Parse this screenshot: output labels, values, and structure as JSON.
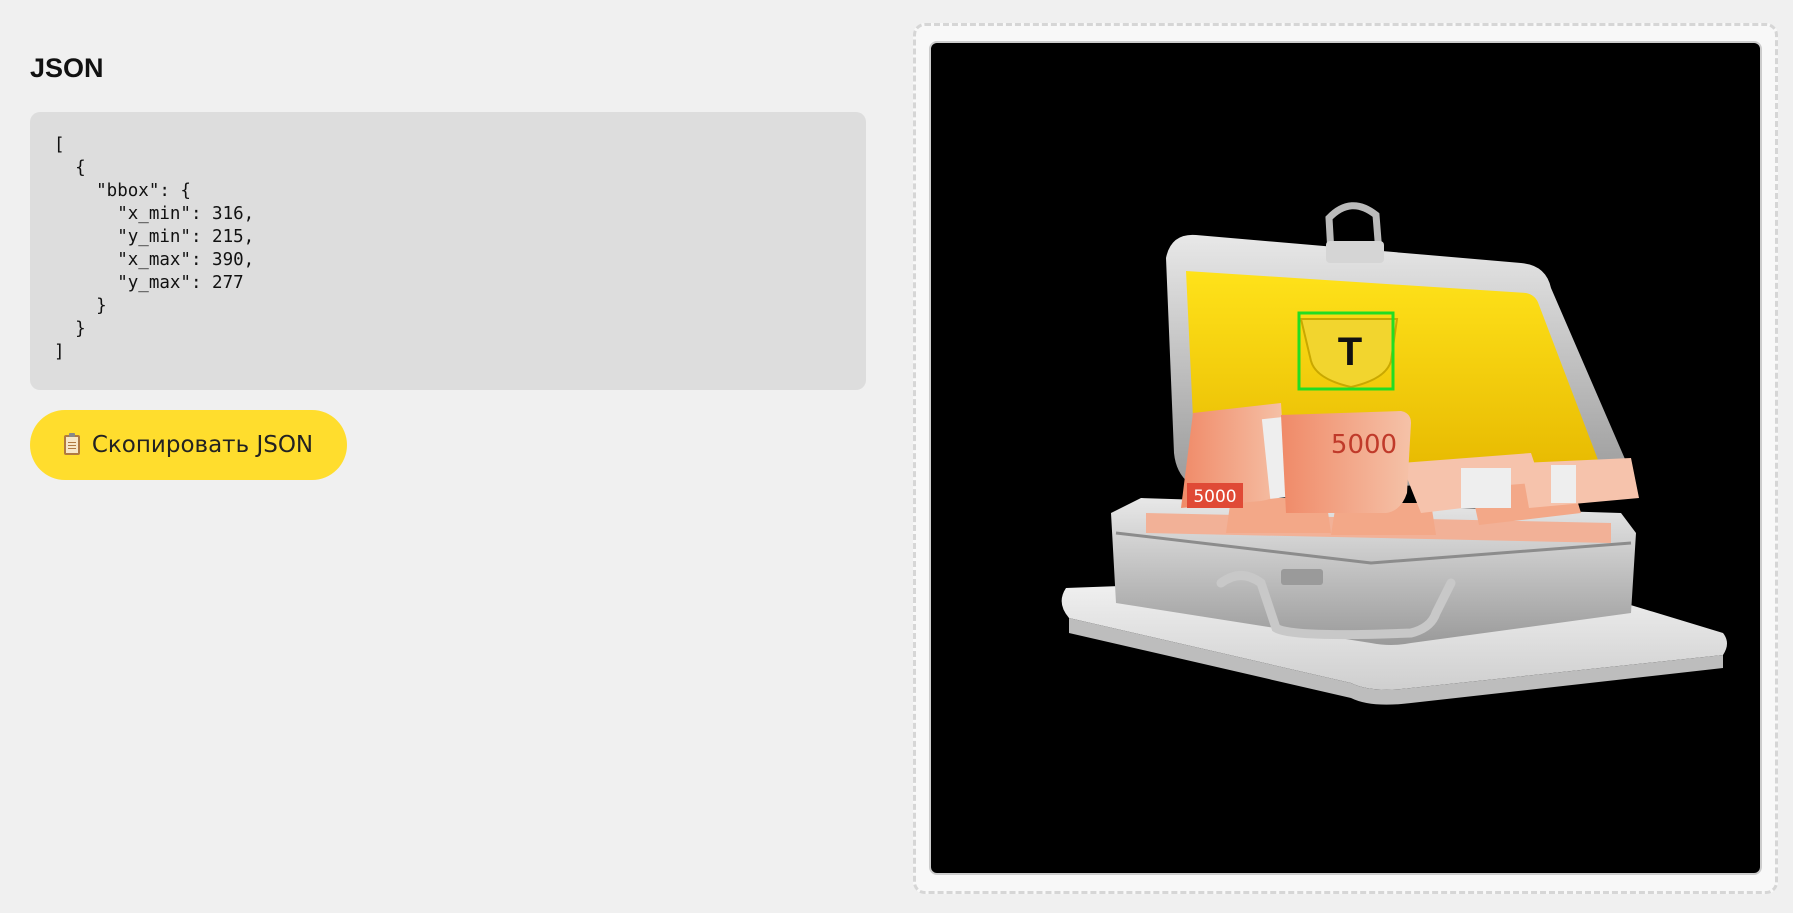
{
  "heading": "JSON",
  "json_text": "[\n  {\n    \"bbox\": {\n      \"x_min\": 316,\n      \"y_min\": 215,\n      \"x_max\": 390,\n      \"y_max\": 277\n    }\n  }\n]",
  "copy_button": {
    "icon": "clipboard-icon",
    "label": "Скопировать JSON"
  },
  "image": {
    "banknote_label": "5000",
    "logo_letter": "Т"
  },
  "colors": {
    "accent": "#ffdd2d",
    "bbox": "#22dd22",
    "code_bg": "#dddddd",
    "page_bg": "#f0f0f0"
  }
}
